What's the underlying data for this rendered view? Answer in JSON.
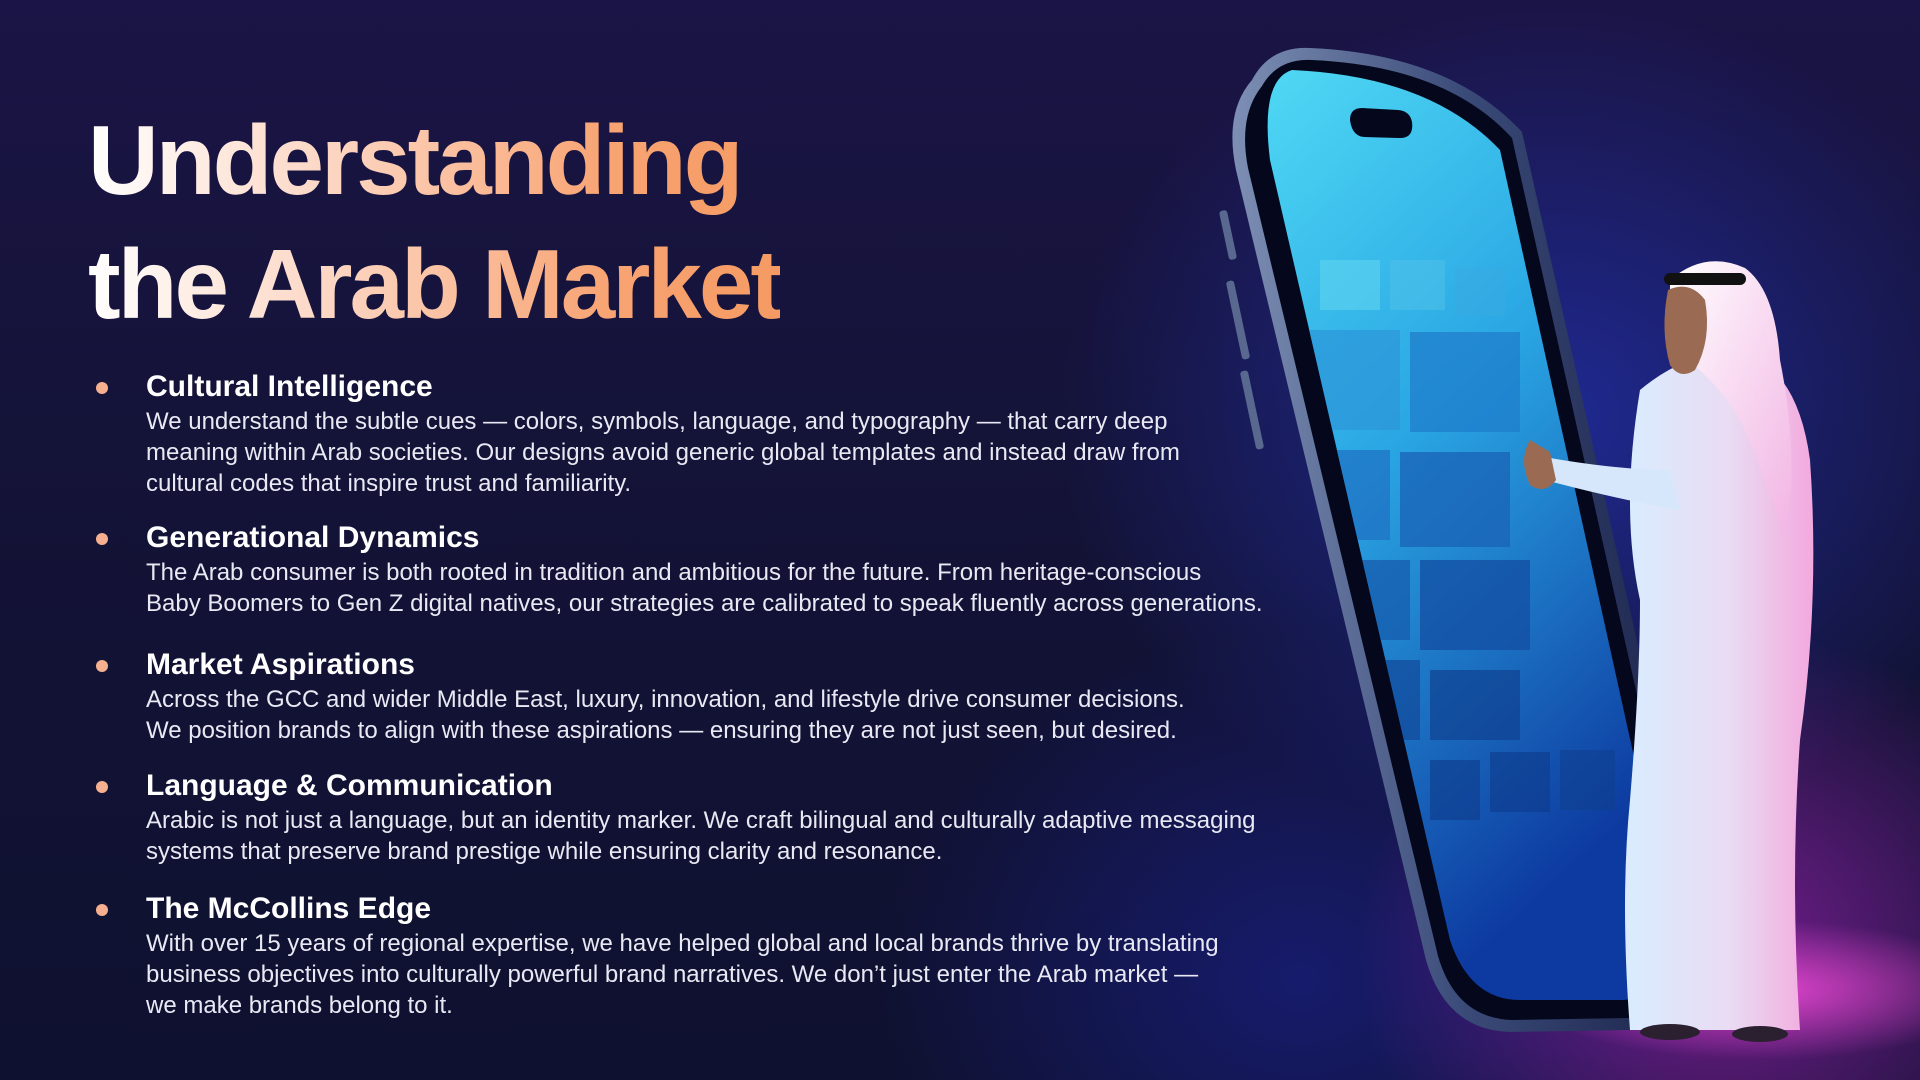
{
  "title": {
    "line1": "Understanding",
    "line2": "the Arab Market"
  },
  "bullets": [
    {
      "heading": "Cultural Intelligence",
      "lines": [
        "We understand the subtle cues — colors, symbols, language, and typography — that carry deep",
        "meaning within Arab societies. Our designs avoid generic global templates and instead draw from",
        "cultural codes that inspire trust and familiarity."
      ]
    },
    {
      "heading": "Generational Dynamics",
      "lines": [
        "The Arab consumer is both rooted in tradition and ambitious for the future. From heritage-conscious",
        "Baby Boomers to Gen Z digital natives, our strategies are calibrated to speak fluently across generations."
      ]
    },
    {
      "heading": "Market Aspirations",
      "lines": [
        "Across the GCC and wider Middle East, luxury, innovation, and lifestyle drive consumer decisions.",
        "We position brands to align with these aspirations — ensuring they are not just seen, but desired."
      ]
    },
    {
      "heading": "Language & Communication",
      "lines": [
        "Arabic is not just a language, but an identity marker. We craft bilingual and culturally adaptive messaging",
        "systems that preserve brand prestige while ensuring clarity and resonance."
      ]
    },
    {
      "heading": "The McCollins Edge",
      "lines": [
        "With over 15 years of regional expertise, we have helped global and local brands thrive by translating",
        "business objectives into culturally powerful brand narratives. We don’t just enter the Arab market —",
        "we make brands belong to it."
      ]
    }
  ],
  "colors": {
    "bullet_dot": "#f6b090",
    "title_gradient_start": "#ffffff",
    "title_gradient_end": "#f59a63",
    "background": "#141338"
  },
  "illustration": {
    "subject": "smartphone-with-media-tiles",
    "figure": "man-in-traditional-dress-touching-screen"
  }
}
